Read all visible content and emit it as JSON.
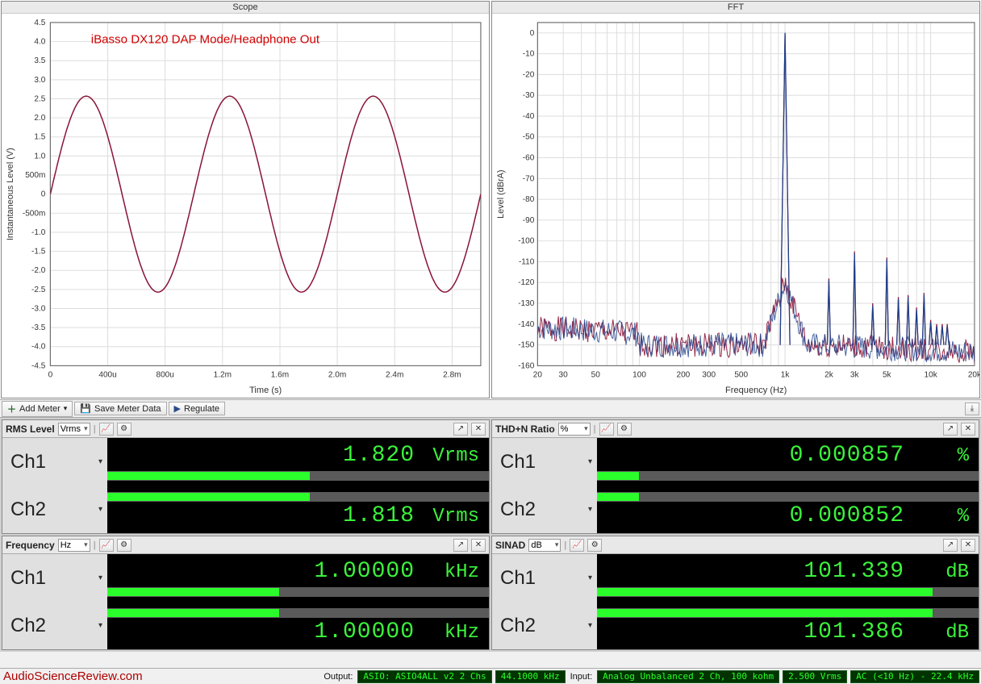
{
  "annotation": "iBasso DX120 DAP Mode/Headphone Out",
  "watermark": "AudioScienceReview.com",
  "chart_data": [
    {
      "type": "line",
      "title": "Scope",
      "xlabel": "Time (s)",
      "ylabel": "Instantaneous Level (V)",
      "xlim": [
        0,
        0.003
      ],
      "ylim": [
        -4.5,
        4.5
      ],
      "xticks": [
        "0",
        "400u",
        "800u",
        "1.2m",
        "1.6m",
        "2.0m",
        "2.4m",
        "2.8m"
      ],
      "yticks": [
        "-4.5",
        "-4.0",
        "-3.5",
        "-3.0",
        "-2.5",
        "-2.0",
        "-1.5",
        "-1.0",
        "-500m",
        "0",
        "500m",
        "1.0",
        "1.5",
        "2.0",
        "2.5",
        "3.0",
        "3.5",
        "4.0",
        "4.5"
      ],
      "series": [
        {
          "name": "Ch1",
          "color": "#8a1538",
          "note": "1 kHz sine, amplitude ≈ 2.57 V"
        },
        {
          "name": "Ch2",
          "color": "#1a3f8a",
          "note": "1 kHz sine, amplitude ≈ 2.57 V (overlaps Ch1)"
        }
      ],
      "signal": {
        "shape": "sine",
        "frequency_hz": 1000,
        "amplitude_v": 2.57,
        "phase_deg": 0
      }
    },
    {
      "type": "line",
      "title": "FFT",
      "xlabel": "Frequency (Hz)",
      "ylabel": "Level (dBrA)",
      "xscale": "log",
      "xlim": [
        20,
        20000
      ],
      "ylim": [
        -160,
        5
      ],
      "xticks": [
        "20",
        "30",
        "50",
        "100",
        "200",
        "300",
        "500",
        "1k",
        "2k",
        "3k",
        "5k",
        "10k",
        "20k"
      ],
      "yticks": [
        "-160",
        "-150",
        "-140",
        "-130",
        "-120",
        "-110",
        "-100",
        "-90",
        "-80",
        "-70",
        "-60",
        "-50",
        "-40",
        "-30",
        "-20",
        "-10",
        "0"
      ],
      "noise_floor_db": -150,
      "fundamental": {
        "frequency_hz": 1000,
        "level_db": 0
      },
      "harmonics": [
        {
          "frequency_hz": 2000,
          "level_db": -118
        },
        {
          "frequency_hz": 3000,
          "level_db": -105
        },
        {
          "frequency_hz": 4000,
          "level_db": -130
        },
        {
          "frequency_hz": 5000,
          "level_db": -108
        },
        {
          "frequency_hz": 6000,
          "level_db": -127
        },
        {
          "frequency_hz": 7000,
          "level_db": -126
        },
        {
          "frequency_hz": 8000,
          "level_db": -132
        },
        {
          "frequency_hz": 9000,
          "level_db": -125
        },
        {
          "frequency_hz": 10000,
          "level_db": -138
        },
        {
          "frequency_hz": 11000,
          "level_db": -140
        },
        {
          "frequency_hz": 12000,
          "level_db": -140
        },
        {
          "frequency_hz": 13000,
          "level_db": -140
        }
      ],
      "series": [
        {
          "name": "Ch1",
          "color": "#1a3f8a"
        },
        {
          "name": "Ch2",
          "color": "#8a1538"
        }
      ]
    }
  ],
  "toolbar": {
    "add_meter": "Add Meter",
    "save_meter": "Save Meter Data",
    "regulate": "Regulate"
  },
  "meters": {
    "rms": {
      "title": "RMS Level",
      "unit_sel": "Vrms",
      "ch1": {
        "label": "Ch1",
        "value": "1.820",
        "unit": "Vrms",
        "bar_pct": 53
      },
      "ch2": {
        "label": "Ch2",
        "value": "1.818",
        "unit": "Vrms",
        "bar_pct": 53
      }
    },
    "thdn": {
      "title": "THD+N Ratio",
      "unit_sel": "%",
      "ch1": {
        "label": "Ch1",
        "value": "0.000857",
        "unit": "%",
        "bar_pct": 11
      },
      "ch2": {
        "label": "Ch2",
        "value": "0.000852",
        "unit": "%",
        "bar_pct": 11
      }
    },
    "freq": {
      "title": "Frequency",
      "unit_sel": "Hz",
      "ch1": {
        "label": "Ch1",
        "value": "1.00000",
        "unit": "kHz",
        "bar_pct": 45
      },
      "ch2": {
        "label": "Ch2",
        "value": "1.00000",
        "unit": "kHz",
        "bar_pct": 45
      }
    },
    "sinad": {
      "title": "SINAD",
      "unit_sel": "dB",
      "ch1": {
        "label": "Ch1",
        "value": "101.339",
        "unit": "dB",
        "bar_pct": 88
      },
      "ch2": {
        "label": "Ch2",
        "value": "101.386",
        "unit": "dB",
        "bar_pct": 88
      }
    }
  },
  "status": {
    "output_label": "Output:",
    "output_dev": "ASIO: ASIO4ALL v2 2 Chs",
    "output_rate": "44.1000 kHz",
    "input_label": "Input:",
    "input_dev": "Analog Unbalanced 2 Ch, 100 kohm",
    "input_level": "2.500 Vrms",
    "input_coupling": "AC (<10 Hz) - 22.4 kHz"
  }
}
